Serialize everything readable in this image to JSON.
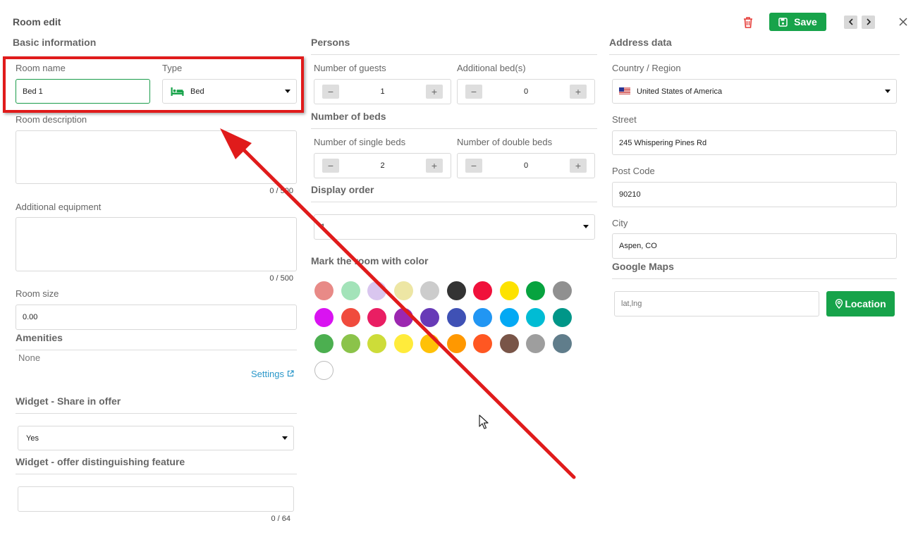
{
  "header": {
    "title": "Room edit",
    "save_label": "Save"
  },
  "basic": {
    "heading": "Basic information",
    "room_name_label": "Room name",
    "room_name_value": "Bed 1",
    "type_label": "Type",
    "type_value": "Bed",
    "description_label": "Room description",
    "description_counter": "0 / 500",
    "equipment_label": "Additional equipment",
    "equipment_counter": "0 / 500",
    "size_label": "Room size",
    "size_value": "0.00",
    "amenities_heading": "Amenities",
    "amenities_value": "None",
    "settings_link": "Settings",
    "widget_share_heading": "Widget - Share in offer",
    "widget_share_value": "Yes",
    "widget_feature_heading": "Widget - offer distinguishing feature",
    "widget_feature_counter": "0 / 64"
  },
  "persons": {
    "heading": "Persons",
    "guests_label": "Number of guests",
    "guests_value": "1",
    "extra_beds_label": "Additional bed(s)",
    "extra_beds_value": "0",
    "beds_heading": "Number of beds",
    "single_label": "Number of single beds",
    "single_value": "2",
    "double_label": "Number of double beds",
    "double_value": "0",
    "minus": "−",
    "plus": "+",
    "display_order_heading": "Display order",
    "display_order_value": "1",
    "color_heading": "Mark the room with color"
  },
  "colors": [
    "#e88a87",
    "#a3e3b9",
    "#d9c6ef",
    "#ede6a4",
    "#cccccc",
    "#333333",
    "#f0113b",
    "#fde200",
    "#07a33f",
    "#909090",
    "#d913f1",
    "#f04b3d",
    "#e91e63",
    "#9c27b0",
    "#673ab7",
    "#3f51b5",
    "#2196f3",
    "#03a9f4",
    "#00bcd4",
    "#009688",
    "#4caf50",
    "#8bc34a",
    "#cddc39",
    "#ffeb3b",
    "#ffc107",
    "#ff9800",
    "#ff5722",
    "#795548",
    "#9e9e9e",
    "#607d8b",
    "#ffffff"
  ],
  "address": {
    "heading": "Address data",
    "country_label": "Country / Region",
    "country_value": "United States of America",
    "street_label": "Street",
    "street_value": "245 Whispering Pines Rd",
    "postcode_label": "Post Code",
    "postcode_value": "90210",
    "city_label": "City",
    "city_value": "Aspen, CO",
    "maps_heading": "Google Maps",
    "latlng_placeholder": "lat,lng",
    "location_button": "Location"
  },
  "icons": {
    "delete": "trash-icon",
    "save": "floppy-disk-icon",
    "prev": "chevron-left-icon",
    "next": "chevron-right-icon",
    "close": "close-icon",
    "bed": "bed-icon",
    "flag": "us-flag-icon",
    "external": "external-link-icon",
    "pin": "map-pin-icon",
    "cursor": "mouse-cursor-icon"
  },
  "annotation": {
    "highlight_color": "#e01b1b",
    "arrow_color": "#e01b1b"
  }
}
